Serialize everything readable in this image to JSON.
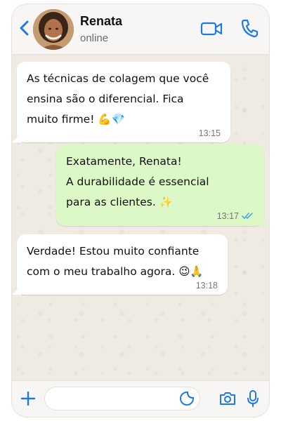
{
  "header": {
    "name": "Renata",
    "status": "online",
    "back_icon": "chevron-left-icon",
    "video_icon": "video-camera-icon",
    "call_icon": "phone-icon"
  },
  "messages": [
    {
      "direction": "incoming",
      "text": "As técnicas de colagem que você\nensina são o diferencial. Fica\nmuito firme! 💪💎",
      "time": "13:15"
    },
    {
      "direction": "outgoing",
      "text": "Exatamente, Renata!\nA durabilidade é essencial\npara as clientes. ✨",
      "time": "13:17",
      "status_icon": "double-check-icon"
    },
    {
      "direction": "incoming",
      "text": "Verdade! Estou muito confiante\ncom o meu trabalho agora. 😉🙏",
      "time": "13:18"
    }
  ],
  "composer": {
    "placeholder": "",
    "value": ""
  },
  "colors": {
    "accent": "#1f7ae0",
    "incoming_bubble": "#ffffff",
    "outgoing_bubble": "#dcf8c6",
    "chat_background": "#efeae2",
    "read_ticks": "#4fa3e8"
  }
}
